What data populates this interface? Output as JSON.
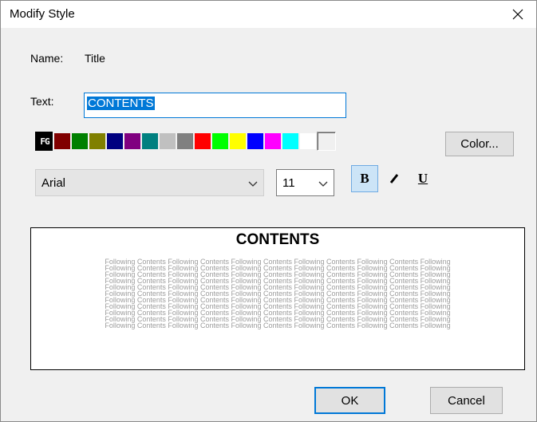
{
  "window": {
    "title": "Modify Style"
  },
  "name_row": {
    "label": "Name:",
    "value": "Title"
  },
  "text_row": {
    "label": "Text:",
    "value": "CONTENTS"
  },
  "palette": {
    "fg_label": "FG",
    "swatches": [
      "#800000",
      "#008000",
      "#808000",
      "#000080",
      "#800080",
      "#008080",
      "#c0c0c0",
      "#808080",
      "#ff0000",
      "#00ff00",
      "#ffff00",
      "#0000ff",
      "#ff00ff",
      "#00ffff",
      "#ffffff"
    ],
    "color_button": "Color..."
  },
  "font": {
    "family": "Arial",
    "size": "11"
  },
  "format": {
    "bold": "B",
    "italic": "I",
    "underline": "U",
    "bold_active": true
  },
  "preview": {
    "title": "CONTENTS",
    "body_lines": [
      "Following Contents Following Contents Following Contents Following Contents Following Contents Following",
      "Following Contents Following Contents Following Contents Following Contents Following Contents Following",
      "Following Contents Following Contents Following Contents Following Contents Following Contents Following",
      "Following Contents Following Contents Following Contents Following Contents Following Contents Following",
      "Following Contents Following Contents Following Contents Following Contents Following Contents Following",
      "Following Contents Following Contents Following Contents Following Contents Following Contents Following",
      "Following Contents Following Contents Following Contents Following Contents Following Contents Following",
      "Following Contents Following Contents Following Contents Following Contents Following Contents Following",
      "Following Contents Following Contents Following Contents Following Contents Following Contents Following",
      "Following Contents Following Contents Following Contents Following Contents Following Contents Following",
      "Following Contents Following Contents Following Contents Following Contents Following Contents Following"
    ]
  },
  "buttons": {
    "ok": "OK",
    "cancel": "Cancel"
  },
  "colors": {
    "accent": "#0078d7",
    "dialog_bg": "#f0f0f0"
  }
}
